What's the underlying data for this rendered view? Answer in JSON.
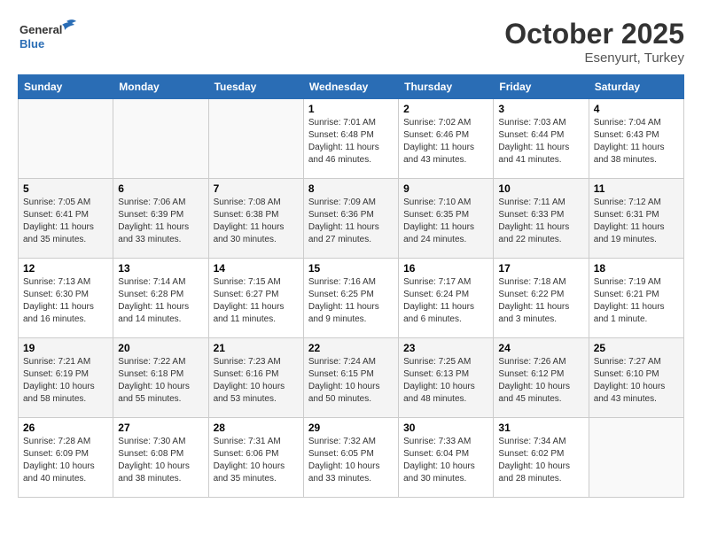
{
  "header": {
    "logo_line1": "General",
    "logo_line2": "Blue",
    "month": "October 2025",
    "location": "Esenyurt, Turkey"
  },
  "weekdays": [
    "Sunday",
    "Monday",
    "Tuesday",
    "Wednesday",
    "Thursday",
    "Friday",
    "Saturday"
  ],
  "weeks": [
    [
      {
        "day": "",
        "detail": ""
      },
      {
        "day": "",
        "detail": ""
      },
      {
        "day": "",
        "detail": ""
      },
      {
        "day": "1",
        "detail": "Sunrise: 7:01 AM\nSunset: 6:48 PM\nDaylight: 11 hours\nand 46 minutes."
      },
      {
        "day": "2",
        "detail": "Sunrise: 7:02 AM\nSunset: 6:46 PM\nDaylight: 11 hours\nand 43 minutes."
      },
      {
        "day": "3",
        "detail": "Sunrise: 7:03 AM\nSunset: 6:44 PM\nDaylight: 11 hours\nand 41 minutes."
      },
      {
        "day": "4",
        "detail": "Sunrise: 7:04 AM\nSunset: 6:43 PM\nDaylight: 11 hours\nand 38 minutes."
      }
    ],
    [
      {
        "day": "5",
        "detail": "Sunrise: 7:05 AM\nSunset: 6:41 PM\nDaylight: 11 hours\nand 35 minutes."
      },
      {
        "day": "6",
        "detail": "Sunrise: 7:06 AM\nSunset: 6:39 PM\nDaylight: 11 hours\nand 33 minutes."
      },
      {
        "day": "7",
        "detail": "Sunrise: 7:08 AM\nSunset: 6:38 PM\nDaylight: 11 hours\nand 30 minutes."
      },
      {
        "day": "8",
        "detail": "Sunrise: 7:09 AM\nSunset: 6:36 PM\nDaylight: 11 hours\nand 27 minutes."
      },
      {
        "day": "9",
        "detail": "Sunrise: 7:10 AM\nSunset: 6:35 PM\nDaylight: 11 hours\nand 24 minutes."
      },
      {
        "day": "10",
        "detail": "Sunrise: 7:11 AM\nSunset: 6:33 PM\nDaylight: 11 hours\nand 22 minutes."
      },
      {
        "day": "11",
        "detail": "Sunrise: 7:12 AM\nSunset: 6:31 PM\nDaylight: 11 hours\nand 19 minutes."
      }
    ],
    [
      {
        "day": "12",
        "detail": "Sunrise: 7:13 AM\nSunset: 6:30 PM\nDaylight: 11 hours\nand 16 minutes."
      },
      {
        "day": "13",
        "detail": "Sunrise: 7:14 AM\nSunset: 6:28 PM\nDaylight: 11 hours\nand 14 minutes."
      },
      {
        "day": "14",
        "detail": "Sunrise: 7:15 AM\nSunset: 6:27 PM\nDaylight: 11 hours\nand 11 minutes."
      },
      {
        "day": "15",
        "detail": "Sunrise: 7:16 AM\nSunset: 6:25 PM\nDaylight: 11 hours\nand 9 minutes."
      },
      {
        "day": "16",
        "detail": "Sunrise: 7:17 AM\nSunset: 6:24 PM\nDaylight: 11 hours\nand 6 minutes."
      },
      {
        "day": "17",
        "detail": "Sunrise: 7:18 AM\nSunset: 6:22 PM\nDaylight: 11 hours\nand 3 minutes."
      },
      {
        "day": "18",
        "detail": "Sunrise: 7:19 AM\nSunset: 6:21 PM\nDaylight: 11 hours\nand 1 minute."
      }
    ],
    [
      {
        "day": "19",
        "detail": "Sunrise: 7:21 AM\nSunset: 6:19 PM\nDaylight: 10 hours\nand 58 minutes."
      },
      {
        "day": "20",
        "detail": "Sunrise: 7:22 AM\nSunset: 6:18 PM\nDaylight: 10 hours\nand 55 minutes."
      },
      {
        "day": "21",
        "detail": "Sunrise: 7:23 AM\nSunset: 6:16 PM\nDaylight: 10 hours\nand 53 minutes."
      },
      {
        "day": "22",
        "detail": "Sunrise: 7:24 AM\nSunset: 6:15 PM\nDaylight: 10 hours\nand 50 minutes."
      },
      {
        "day": "23",
        "detail": "Sunrise: 7:25 AM\nSunset: 6:13 PM\nDaylight: 10 hours\nand 48 minutes."
      },
      {
        "day": "24",
        "detail": "Sunrise: 7:26 AM\nSunset: 6:12 PM\nDaylight: 10 hours\nand 45 minutes."
      },
      {
        "day": "25",
        "detail": "Sunrise: 7:27 AM\nSunset: 6:10 PM\nDaylight: 10 hours\nand 43 minutes."
      }
    ],
    [
      {
        "day": "26",
        "detail": "Sunrise: 7:28 AM\nSunset: 6:09 PM\nDaylight: 10 hours\nand 40 minutes."
      },
      {
        "day": "27",
        "detail": "Sunrise: 7:30 AM\nSunset: 6:08 PM\nDaylight: 10 hours\nand 38 minutes."
      },
      {
        "day": "28",
        "detail": "Sunrise: 7:31 AM\nSunset: 6:06 PM\nDaylight: 10 hours\nand 35 minutes."
      },
      {
        "day": "29",
        "detail": "Sunrise: 7:32 AM\nSunset: 6:05 PM\nDaylight: 10 hours\nand 33 minutes."
      },
      {
        "day": "30",
        "detail": "Sunrise: 7:33 AM\nSunset: 6:04 PM\nDaylight: 10 hours\nand 30 minutes."
      },
      {
        "day": "31",
        "detail": "Sunrise: 7:34 AM\nSunset: 6:02 PM\nDaylight: 10 hours\nand 28 minutes."
      },
      {
        "day": "",
        "detail": ""
      }
    ]
  ]
}
